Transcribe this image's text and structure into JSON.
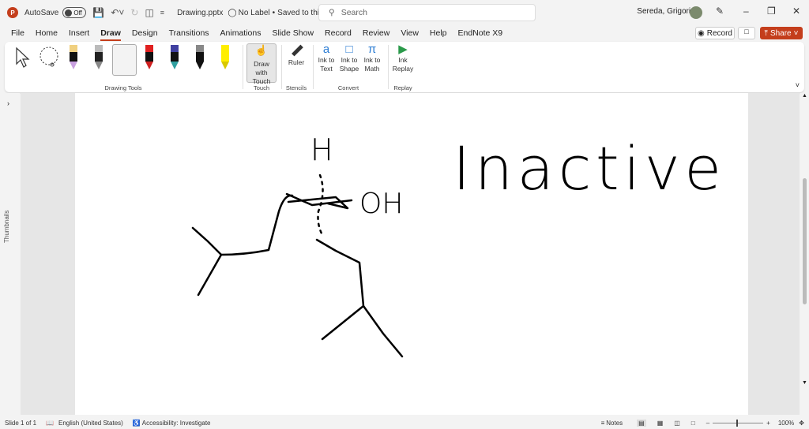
{
  "titlebar": {
    "autosave": "AutoSave",
    "autosave_state": "Off",
    "filename": "Drawing.pptx",
    "label": "No Label",
    "saved": "Saved to this PC",
    "search_placeholder": "Search",
    "user": "Sereda, Grigoriy A"
  },
  "menu": [
    "File",
    "Home",
    "Insert",
    "Draw",
    "Design",
    "Transitions",
    "Animations",
    "Slide Show",
    "Record",
    "Review",
    "View",
    "Help",
    "EndNote X9"
  ],
  "actions": {
    "record": "Record",
    "share": "Share"
  },
  "ribbon": {
    "draw_with_touch": "Draw with Touch",
    "ruler": "Ruler",
    "ink_to_text": "Ink to Text",
    "ink_to_shape": "Ink to Shape",
    "ink_to_math": "Ink to Math",
    "ink_replay": "Ink Replay",
    "groups": {
      "drawing_tools": "Drawing Tools",
      "touch": "Touch",
      "stencils": "Stencils",
      "convert": "Convert",
      "replay": "Replay"
    },
    "pens": [
      {
        "top": "#f0d080",
        "body": "#111",
        "tip": "#c9a0e0"
      },
      {
        "top": "#bbb",
        "body": "#222",
        "tip": "#888"
      },
      {
        "top": "#111",
        "body": "#111",
        "tip": "#111"
      },
      {
        "top": "#e02020",
        "body": "#111",
        "tip": "#d02020"
      },
      {
        "top": "#4040a0",
        "body": "#111",
        "tip": "#30a0a0"
      },
      {
        "top": "#888",
        "body": "#111",
        "tip": "#111"
      },
      {
        "top": "#ffee00",
        "body": "#ffee00",
        "tip": "#d8c800"
      }
    ]
  },
  "thumbnails": "Thumbnails",
  "slide_ink": {
    "title": "Inactive",
    "top_label": "H",
    "right_label": "OH"
  },
  "status": {
    "slide": "Slide 1 of 1",
    "language": "English (United States)",
    "accessibility": "Accessibility: Investigate",
    "notes": "Notes",
    "zoom": "100%"
  }
}
